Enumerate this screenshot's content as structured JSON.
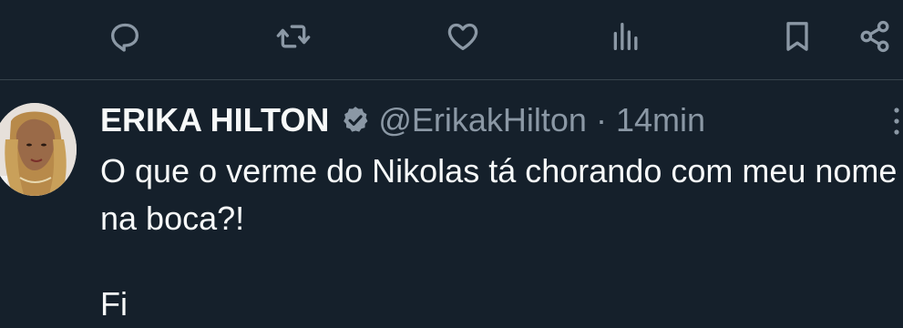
{
  "actions": [
    {
      "name": "reply",
      "icon": "reply-icon"
    },
    {
      "name": "retweet",
      "icon": "retweet-icon"
    },
    {
      "name": "like",
      "icon": "heart-icon"
    },
    {
      "name": "views",
      "icon": "views-icon"
    },
    {
      "name": "bookmark",
      "icon": "bookmark-icon"
    },
    {
      "name": "share",
      "icon": "share-icon"
    }
  ],
  "tweet": {
    "author_name": "ERIKA HILTON",
    "handle": "@ErikakHilton",
    "separator": "·",
    "time": "14min",
    "text": "O que o verme do Nikolas tá chorando com meu nome na boca?!",
    "text_cut_off": "Fi"
  },
  "colors": {
    "background": "#15202b",
    "primary_text": "#f7f9f9",
    "secondary_text": "#8b98a5",
    "verified_badge": "#8b98a5",
    "divider": "#38444d"
  }
}
